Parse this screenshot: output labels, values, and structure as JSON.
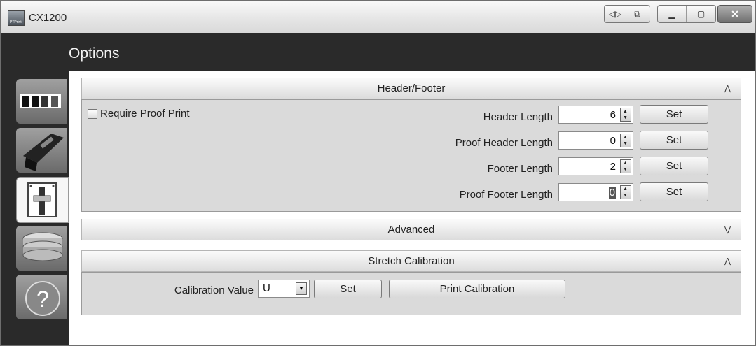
{
  "window": {
    "title": "CX1200",
    "app_icon_text": "PTPrint",
    "controls": [
      "nav-arrows-icon",
      "export-icon",
      "minimize-icon",
      "maximize-icon",
      "close-icon"
    ]
  },
  "page": {
    "title": "Options"
  },
  "sidebar": {
    "items": [
      {
        "icon": "ribbon-strip-icon",
        "active": false
      },
      {
        "icon": "printer-head-icon",
        "active": false
      },
      {
        "icon": "slider-settings-icon",
        "active": true
      },
      {
        "icon": "coin-stack-icon",
        "active": false
      },
      {
        "icon": "help-icon",
        "active": false
      }
    ]
  },
  "header_footer": {
    "title": "Header/Footer",
    "chevron": "⌃",
    "require_proof_print": {
      "label": "Require Proof Print",
      "checked": false
    },
    "rows": [
      {
        "label": "Header Length",
        "value": "6",
        "button": "Set"
      },
      {
        "label": "Proof Header Length",
        "value": "0",
        "button": "Set"
      },
      {
        "label": "Footer Length",
        "value": "2",
        "button": "Set"
      },
      {
        "label": "Proof Footer Length",
        "value": "0",
        "button": "Set"
      }
    ]
  },
  "advanced": {
    "title": "Advanced",
    "chevron": "⌄"
  },
  "stretch_calibration": {
    "title": "Stretch Calibration",
    "chevron": "⌃",
    "label": "Calibration Value",
    "value": "U",
    "set_button": "Set",
    "print_button": "Print Calibration"
  }
}
